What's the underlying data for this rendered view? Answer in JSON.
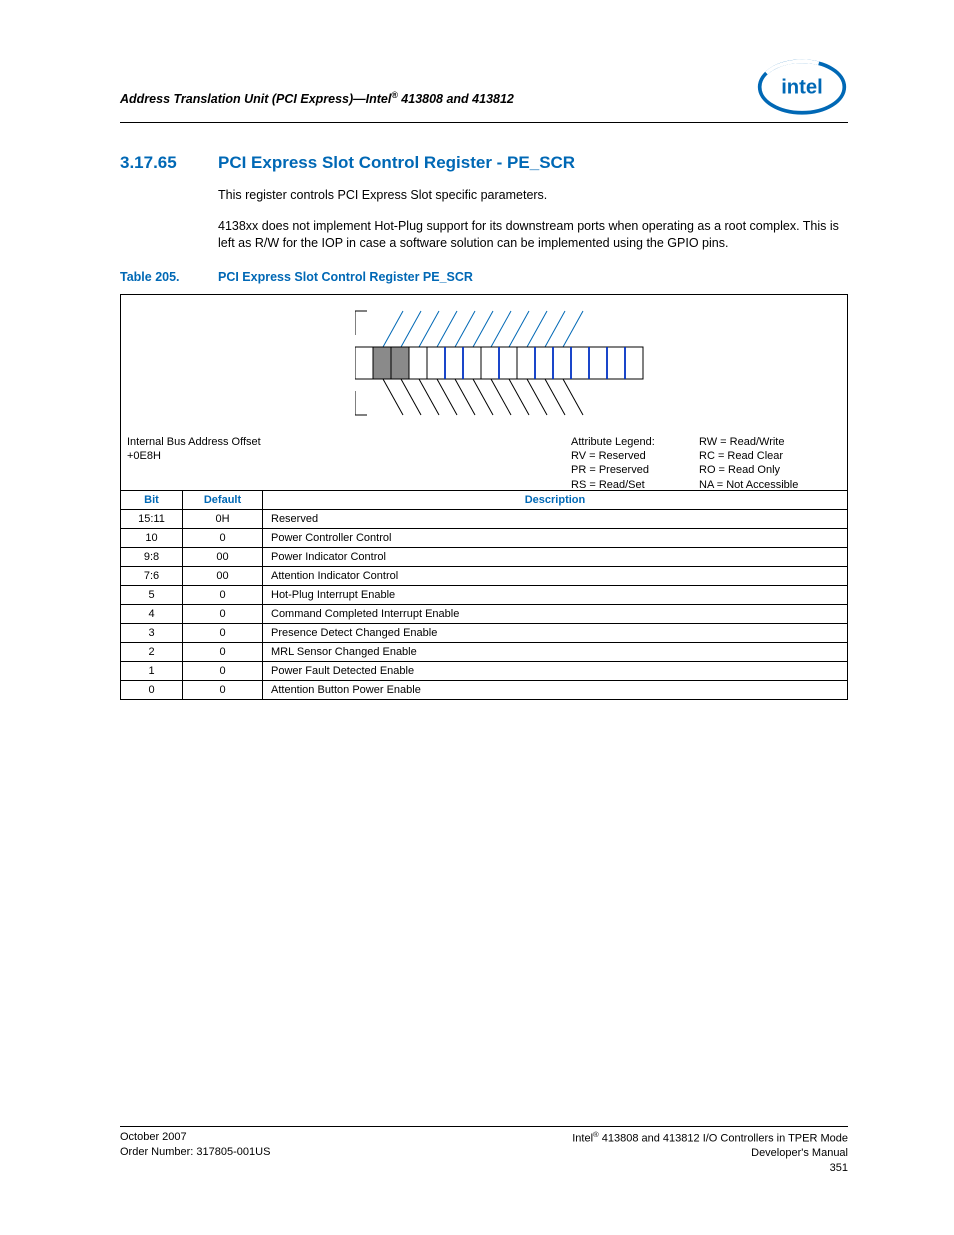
{
  "header": {
    "running_title": "Address Translation Unit (PCI Express)—Intel® 413808 and 413812"
  },
  "section": {
    "number": "3.17.65",
    "title": "PCI Express Slot Control Register - PE_SCR",
    "para1": "This register controls PCI Express Slot specific parameters.",
    "para2": "4138xx does not implement Hot-Plug support for its downstream ports when operating as a root complex. This is left as R/W for the IOP in case a software solution can be implemented using the GPIO pins."
  },
  "table_caption": {
    "number": "Table 205.",
    "title": "PCI Express Slot Control Register PE_SCR"
  },
  "offset": {
    "label": "Internal Bus Address Offset",
    "value": "+0E8H"
  },
  "legend": {
    "title": "Attribute Legend:",
    "rv": "RV = Reserved",
    "pr": "PR = Preserved",
    "rs": "RS = Read/Set",
    "rw": "RW = Read/Write",
    "rc": "RC = Read Clear",
    "ro": "RO = Read Only",
    "na": "NA = Not Accessible"
  },
  "columns": {
    "bit": "Bit",
    "default": "Default",
    "description": "Description"
  },
  "rows": [
    {
      "bit": "15:11",
      "default": "0H",
      "desc": "Reserved"
    },
    {
      "bit": "10",
      "default": "0",
      "desc": "Power Controller Control"
    },
    {
      "bit": "9:8",
      "default": "00",
      "desc": "Power Indicator Control"
    },
    {
      "bit": "7:6",
      "default": "00",
      "desc": "Attention Indicator Control"
    },
    {
      "bit": "5",
      "default": "0",
      "desc": "Hot-Plug Interrupt Enable"
    },
    {
      "bit": "4",
      "default": "0",
      "desc": "Command Completed Interrupt Enable"
    },
    {
      "bit": "3",
      "default": "0",
      "desc": "Presence Detect Changed Enable"
    },
    {
      "bit": "2",
      "default": "0",
      "desc": "MRL Sensor Changed Enable"
    },
    {
      "bit": "1",
      "default": "0",
      "desc": "Power Fault Detected Enable"
    },
    {
      "bit": "0",
      "default": "0",
      "desc": "Attention Button Power Enable"
    }
  ],
  "footer": {
    "date": "October 2007",
    "order": "Order Number: 317805-001US",
    "product": "Intel® 413808 and 413812 I/O Controllers in TPER Mode",
    "docname": "Developer's Manual",
    "page": "351"
  }
}
